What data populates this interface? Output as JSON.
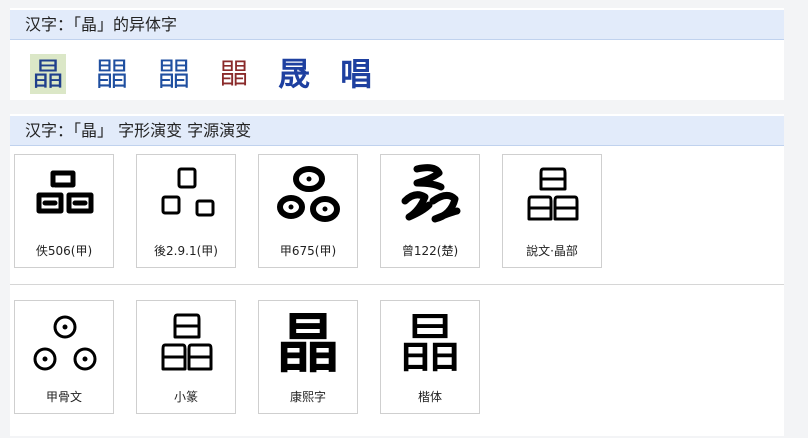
{
  "variants": {
    "title": "汉字：「晶」的异体字",
    "chars": [
      "晶",
      "𣊫",
      "𣊫",
      "𣊫",
      "晟",
      "唱"
    ]
  },
  "evolution": {
    "title": "汉字：「晶」 字形演变 字源演变",
    "row1": [
      {
        "label": "佚506(甲)",
        "icon": "oracle-bone-glyph"
      },
      {
        "label": "後2.9.1(甲)",
        "icon": "oracle-bone-glyph"
      },
      {
        "label": "甲675(甲)",
        "icon": "oracle-bone-glyph"
      },
      {
        "label": "曾122(楚)",
        "icon": "chu-script-glyph"
      },
      {
        "label": "說文·晶部",
        "icon": "shuowen-glyph"
      }
    ],
    "row2": [
      {
        "label": "甲骨文",
        "icon": "oracle-bone-glyph"
      },
      {
        "label": "小篆",
        "icon": "small-seal-glyph"
      },
      {
        "label": "康熙字",
        "glyph": "晶"
      },
      {
        "label": "楷体",
        "glyph": "晶"
      }
    ]
  }
}
